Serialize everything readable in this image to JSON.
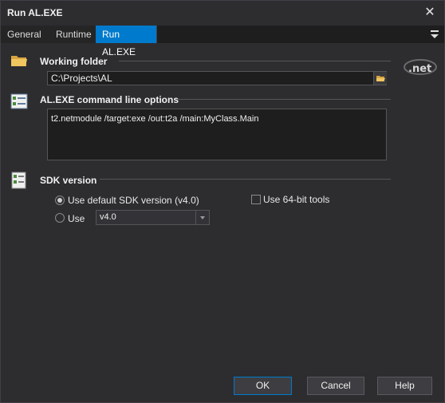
{
  "window": {
    "title": "Run AL.EXE"
  },
  "tabs": [
    {
      "label": "General"
    },
    {
      "label": "Runtime"
    },
    {
      "label": "Run AL.EXE"
    }
  ],
  "working_folder": {
    "label": "Working folder",
    "value": "C:\\Projects\\AL"
  },
  "command_line": {
    "label": "AL.EXE command line options",
    "value": "t2.netmodule /target:exe /out:t2a /main:MyClass.Main"
  },
  "sdk": {
    "label": "SDK version",
    "use_default_label": "Use default SDK version (v4.0)",
    "use_default_checked": true,
    "use_label": "Use",
    "version_value": "v4.0",
    "use_64bit_label": "Use 64-bit tools",
    "use_64bit_checked": false
  },
  "buttons": {
    "ok": "OK",
    "cancel": "Cancel",
    "help": "Help"
  },
  "colors": {
    "accent": "#007acc",
    "background": "#2d2d30",
    "input_bg": "#1e1e1e"
  },
  "icons": [
    "close-icon",
    "folder-icon",
    "checklist-icon",
    "browse-folder-icon",
    "menu-icon",
    "dotnet-logo-icon"
  ]
}
